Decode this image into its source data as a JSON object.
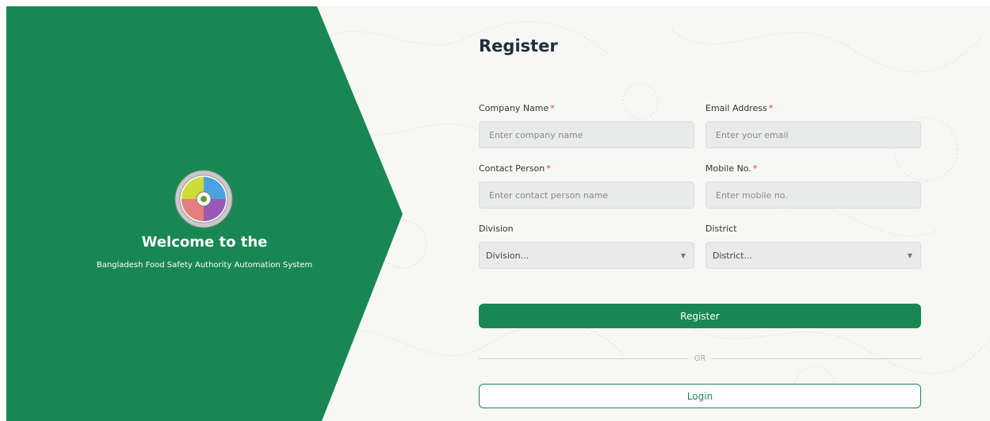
{
  "colors": {
    "brand_green": "#198754",
    "required": "#dc3545"
  },
  "welcome": {
    "logo_icon": "bfsa-logo-icon",
    "title": "Welcome to the",
    "subtitle": "Bangladesh Food Safety Authority Automation System"
  },
  "form": {
    "title": "Register",
    "required_mark": "*",
    "company_name": {
      "label": "Company Name",
      "placeholder": "Enter company name"
    },
    "email": {
      "label": "Email Address",
      "placeholder": "Enter your email"
    },
    "contact_person": {
      "label": "Contact Person",
      "placeholder": "Enter contact person name"
    },
    "mobile": {
      "label": "Mobile No.",
      "placeholder": "Enter mobile no."
    },
    "division": {
      "label": "Division",
      "value": "Division..."
    },
    "district": {
      "label": "District",
      "value": "District..."
    },
    "register_button": "Register",
    "or_text": "OR",
    "login_button": "Login"
  }
}
